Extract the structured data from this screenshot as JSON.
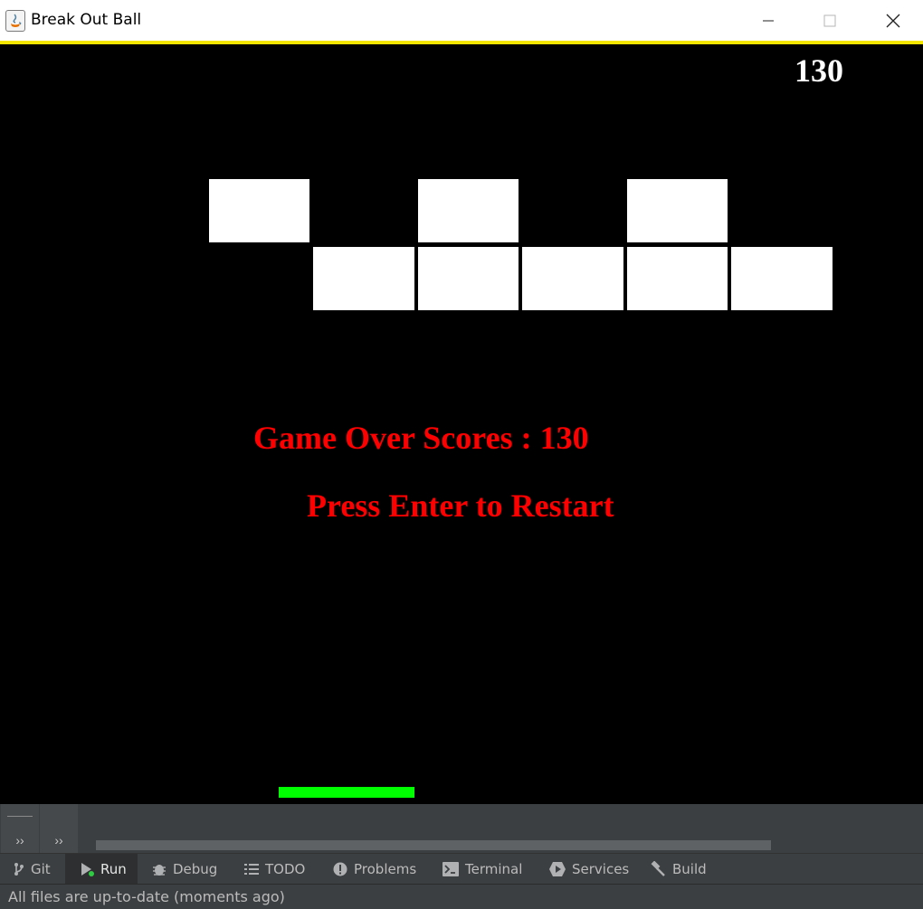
{
  "window": {
    "title": "Break Out Ball",
    "minimize_icon": "minimize-icon",
    "maximize_icon": "maximize-icon",
    "close_icon": "close-icon"
  },
  "game": {
    "score": "130",
    "game_over_text": "Game Over Scores : 130",
    "restart_text": "Press Enter to Restart",
    "paddle_color": "#00ff00",
    "brick_color": "#ffffff",
    "message_color": "#ff0000"
  },
  "run_panel": {
    "buttons": [
      "››",
      "››"
    ]
  },
  "tool_tabs": [
    {
      "label": "Git",
      "icon": "git-branch-icon"
    },
    {
      "label": "Run",
      "icon": "run-icon"
    },
    {
      "label": "Debug",
      "icon": "bug-icon"
    },
    {
      "label": "TODO",
      "icon": "list-icon"
    },
    {
      "label": "Problems",
      "icon": "warning-icon"
    },
    {
      "label": "Terminal",
      "icon": "terminal-icon"
    },
    {
      "label": "Services",
      "icon": "services-icon"
    },
    {
      "label": "Build",
      "icon": "hammer-icon"
    }
  ],
  "status_bar": {
    "text": "All files are up-to-date (moments ago)"
  }
}
